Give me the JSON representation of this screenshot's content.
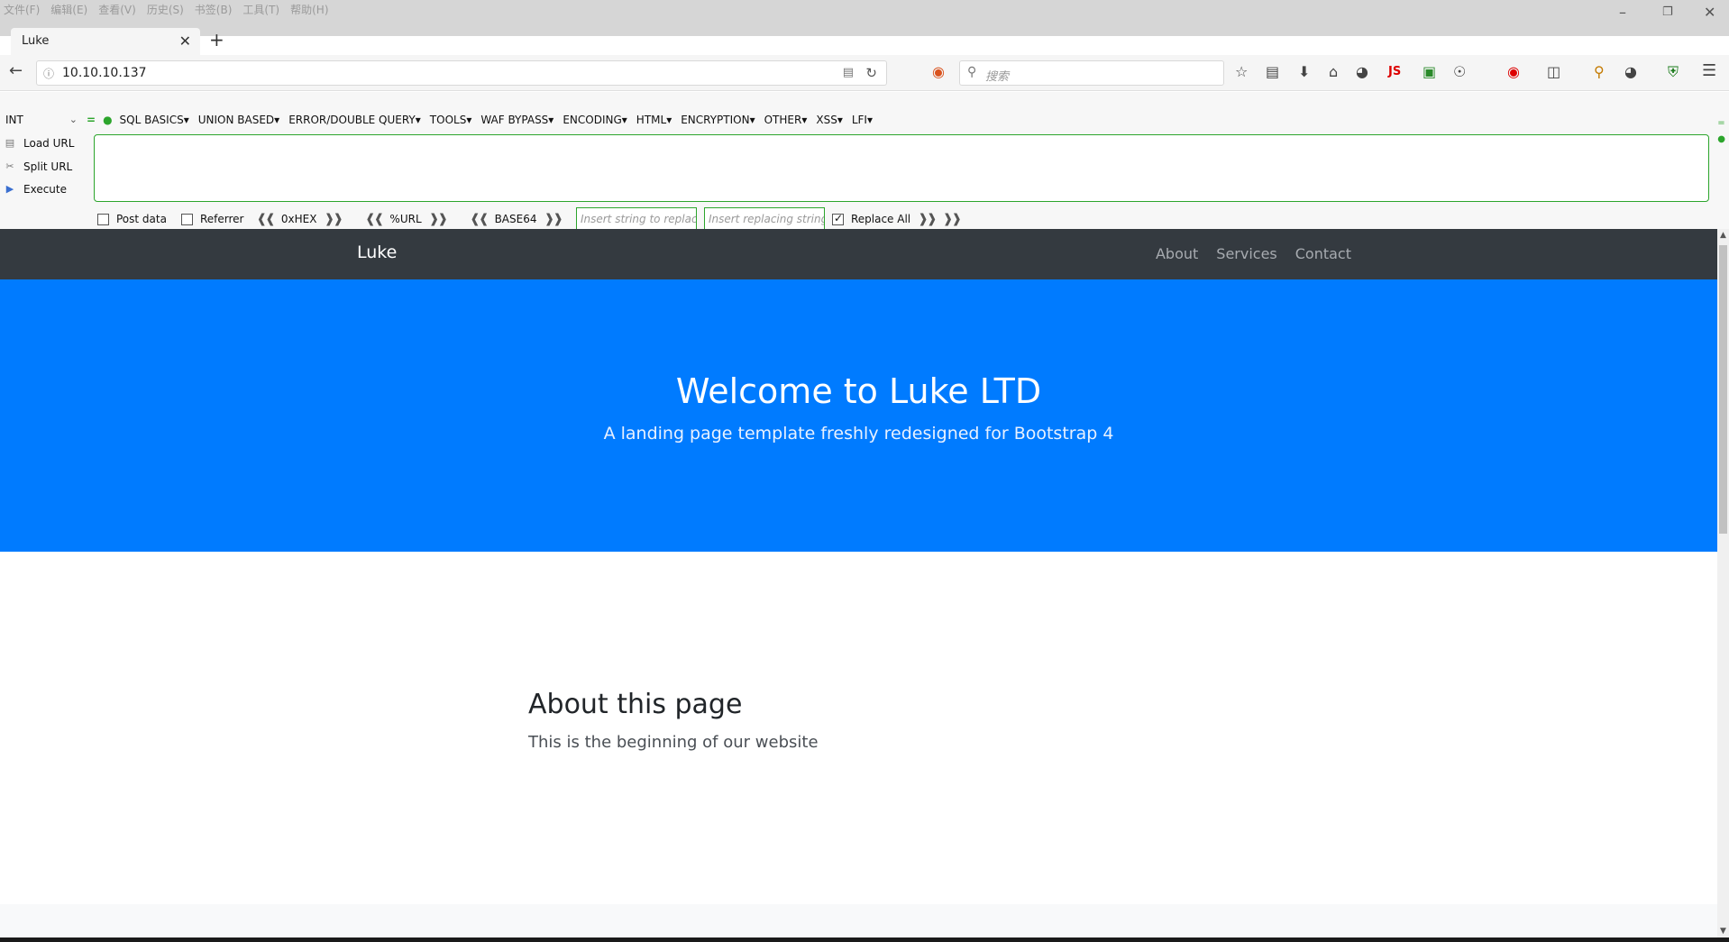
{
  "menubar": {
    "items": [
      "文件(F)",
      "编辑(E)",
      "查看(V)",
      "历史(S)",
      "书签(B)",
      "工具(T)",
      "帮助(H)"
    ]
  },
  "tab": {
    "title": "Luke"
  },
  "navbar": {
    "url": "10.10.10.137",
    "search_placeholder": "搜索",
    "js_label": "JS"
  },
  "hackbar": {
    "select_value": "INT",
    "menu": [
      "SQL BASICS▾",
      "UNION BASED▾",
      "ERROR/DOUBLE QUERY▾",
      "TOOLS▾",
      "WAF BYPASS▾",
      "ENCODING▾",
      "HTML▾",
      "ENCRYPTION▾",
      "OTHER▾",
      "XSS▾",
      "LFI▾"
    ],
    "load_url": "Load URL",
    "split_url": "Split URL",
    "execute": "Execute",
    "post_data": "Post data",
    "referrer": "Referrer",
    "hex": "0xHEX",
    "url_enc": "%URL",
    "base64": "BASE64",
    "replace_placeholder": "Insert string to replace",
    "replacing_placeholder": "Insert replacing string",
    "replace_all": "Replace All"
  },
  "site": {
    "brand": "Luke",
    "links": [
      "About",
      "Services",
      "Contact"
    ],
    "hero_title": "Welcome to Luke LTD",
    "hero_subtitle": "A landing page template freshly redesigned for Bootstrap 4",
    "about_title": "About this page",
    "about_text": "This is the beginning of our website"
  },
  "colors": {
    "hero": "#007bff",
    "site_nav": "#343a40",
    "hackbar_accent": "#2ca52c"
  }
}
